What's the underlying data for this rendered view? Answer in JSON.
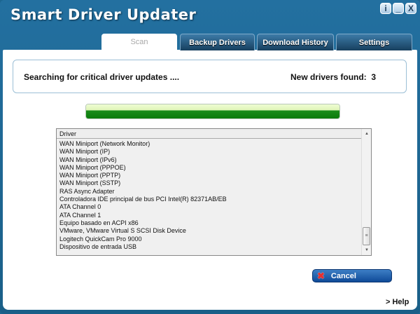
{
  "app": {
    "title": "Smart Driver Updater",
    "window_buttons": {
      "info": "i",
      "minimize": "_",
      "close": "X"
    }
  },
  "tabs": [
    {
      "label": "Scan",
      "active": true
    },
    {
      "label": "Backup Drivers"
    },
    {
      "label": "Download History"
    },
    {
      "label": "Settings"
    }
  ],
  "status": {
    "message": "Searching for critical driver updates ....",
    "found_label": "New drivers found:",
    "found_count": "3"
  },
  "progress": {
    "percent": 100
  },
  "list": {
    "header": "Driver",
    "rows": [
      "WAN Miniport (Network Monitor)",
      "WAN Miniport (IP)",
      "WAN Miniport (IPv6)",
      "WAN Miniport (PPPOE)",
      "WAN Miniport (PPTP)",
      "WAN Miniport (SSTP)",
      "RAS Async Adapter",
      "Controladora IDE principal de bus PCI Intel(R) 82371AB/EB",
      "ATA Channel 0",
      "ATA Channel 1",
      "Equipo basado en ACPI x86",
      "VMware, VMware Virtual S SCSI Disk Device",
      "Logitech QuickCam Pro 9000",
      "Dispositivo de entrada USB"
    ]
  },
  "buttons": {
    "cancel": "Cancel",
    "help": "> Help"
  }
}
